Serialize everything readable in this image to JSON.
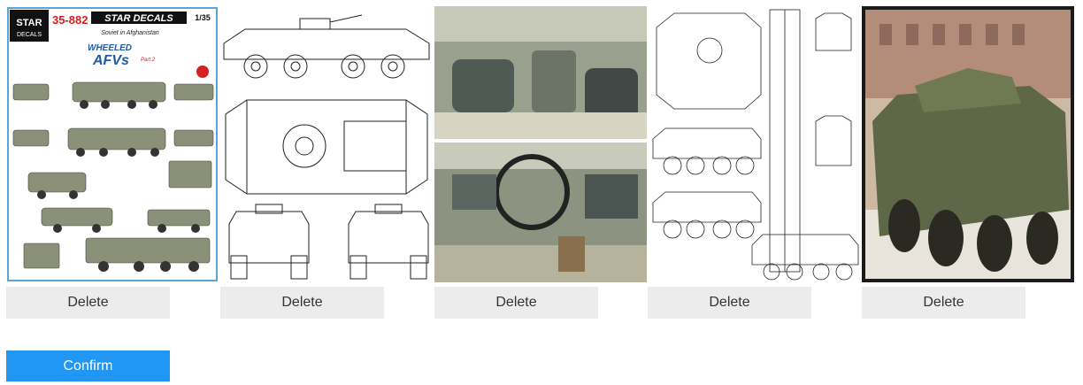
{
  "gallery": {
    "cards": [
      {
        "delete_label": "Delete",
        "image_subject": "decal-sheet-image"
      },
      {
        "delete_label": "Delete",
        "image_subject": "vehicle-line-drawing-image"
      },
      {
        "delete_label": "Delete",
        "image_subject": "vehicle-interior-photo"
      },
      {
        "delete_label": "Delete",
        "image_subject": "vehicle-blueprint-image"
      },
      {
        "delete_label": "Delete",
        "image_subject": "armored-vehicle-photo"
      }
    ]
  },
  "decal_sheet": {
    "code": "35-882",
    "brand": "STAR DECALS",
    "scale": "1/35",
    "subtitle": "Soviet in Afghanistan",
    "title_line1": "WHEELED",
    "title_line2": "AFVs",
    "part": "Part 2",
    "brand_logo_top": "STAR",
    "brand_logo_bottom": "DECALS"
  },
  "actions": {
    "confirm_label": "Confirm"
  },
  "colors": {
    "accent": "#2196f3",
    "button_bg": "#ececec"
  }
}
